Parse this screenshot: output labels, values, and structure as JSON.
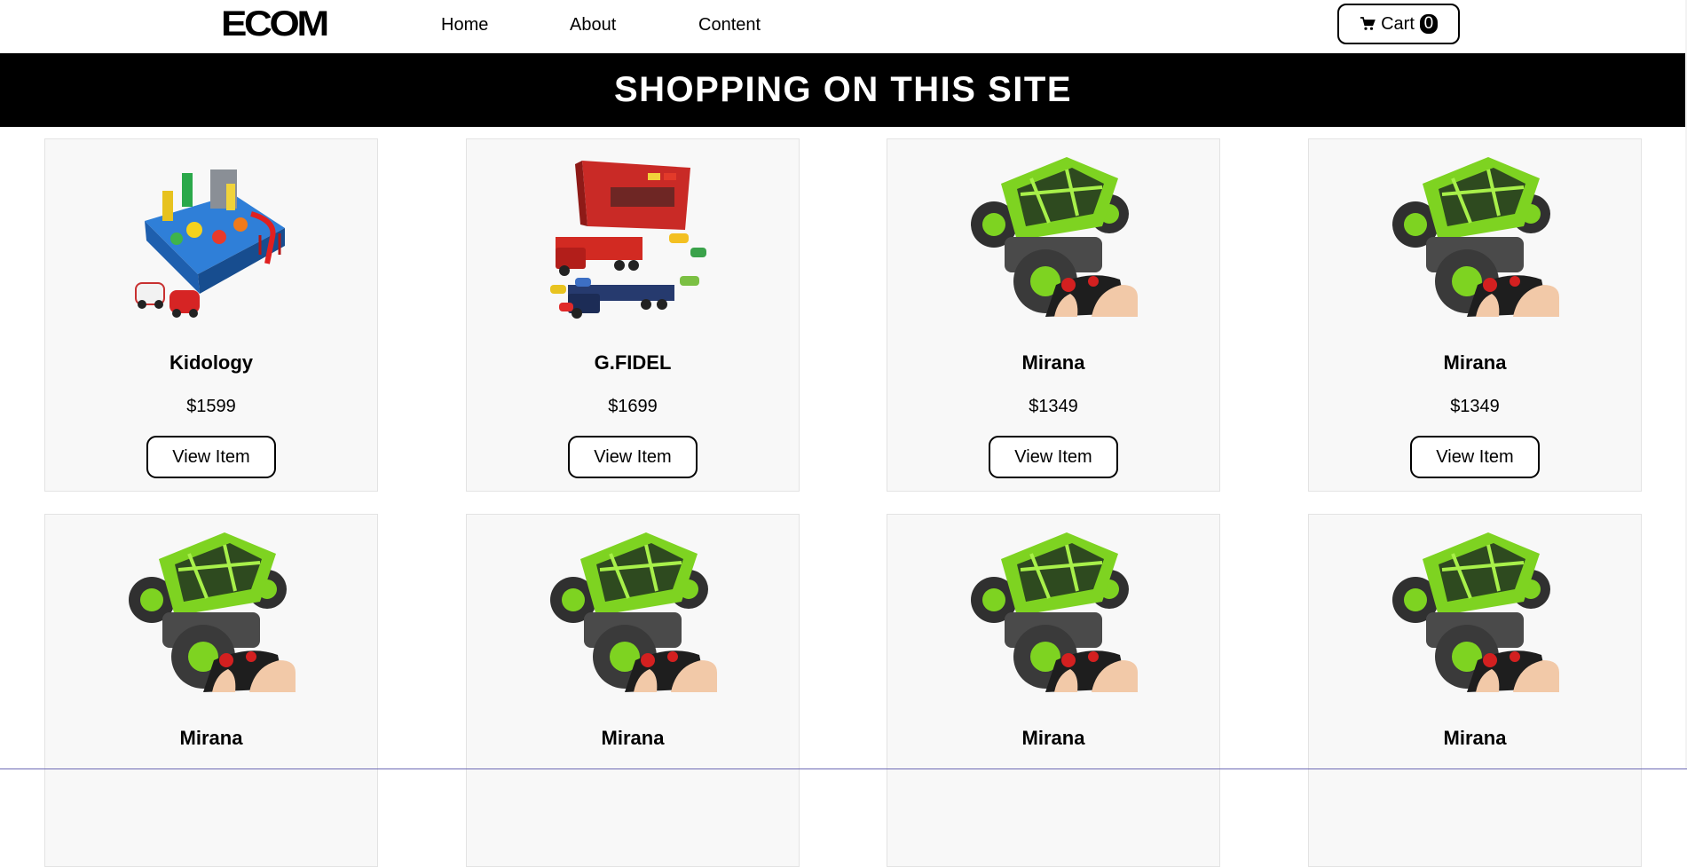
{
  "header": {
    "logo": "ECOM",
    "nav": [
      {
        "label": "Home"
      },
      {
        "label": "About"
      },
      {
        "label": "Content"
      }
    ],
    "cart": {
      "icon": "cart-icon",
      "label": "Cart",
      "count": "0"
    }
  },
  "banner": {
    "title": "SHOPPING ON THIS SITE"
  },
  "products": [
    {
      "name": "Kidology",
      "price": "$1599",
      "button": "View Item",
      "image": "track-playset"
    },
    {
      "name": "G.FIDEL",
      "price": "$1699",
      "button": "View Item",
      "image": "car-carrier"
    },
    {
      "name": "Mirana",
      "price": "$1349",
      "button": "View Item",
      "image": "rc-truck"
    },
    {
      "name": "Mirana",
      "price": "$1349",
      "button": "View Item",
      "image": "rc-truck"
    },
    {
      "name": "Mirana",
      "price": "",
      "button": "",
      "image": "rc-truck"
    },
    {
      "name": "Mirana",
      "price": "",
      "button": "",
      "image": "rc-truck"
    },
    {
      "name": "Mirana",
      "price": "",
      "button": "",
      "image": "rc-truck"
    },
    {
      "name": "Mirana",
      "price": "",
      "button": "",
      "image": "rc-truck"
    }
  ],
  "colors": {
    "banner_bg": "#000000",
    "card_bg": "#f8f8f8",
    "rc_green": "#7ed321",
    "track_blue": "#2f7fd8",
    "truck_red": "#d42a20"
  }
}
